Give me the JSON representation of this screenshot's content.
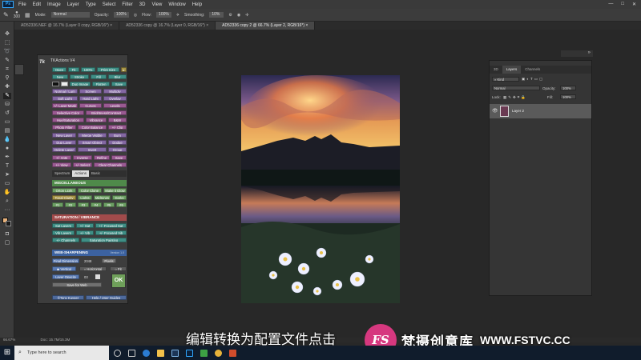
{
  "menubar": {
    "app_badge": "Ps",
    "items": [
      "File",
      "Edit",
      "Image",
      "Layer",
      "Type",
      "Select",
      "Filter",
      "3D",
      "View",
      "Window",
      "Help"
    ],
    "window_controls": [
      "—",
      "□",
      "✕"
    ]
  },
  "options": {
    "brush_size": "300",
    "mode_label": "Mode:",
    "mode_value": "Normal",
    "opacity_label": "Opacity:",
    "opacity_value": "100%",
    "flow_label": "Flow:",
    "flow_value": "100%",
    "smoothing_label": "Smoothing:",
    "smoothing_value": "10%"
  },
  "doc_tabs": [
    {
      "label": "AD52336.NEF @ 16.7% (Layer 0 copy, RGB/16*) ×",
      "active": false
    },
    {
      "label": "AD52336 copy @ 16.7% (Layer 0, RGB/16*) ×",
      "active": false
    },
    {
      "label": "AD52336 copy 2 @ 66.7% (Layer 2, RGB/16*) ×",
      "active": true
    }
  ],
  "tk_panel": {
    "title": "TKActions V4",
    "logo": "Tk",
    "row1": [
      "Open",
      "Fit",
      "100%",
      "Print Size",
      "▸"
    ],
    "row2": [
      "New",
      "Stroke",
      "Fill",
      "Blur"
    ],
    "row3": [
      "Dup Image",
      "Flatten",
      "Save"
    ],
    "row4": [
      "Normal / Lum",
      "Screen",
      "Multiply"
    ],
    "row5": [
      "Soft Light",
      "Hard Light",
      "Overlay"
    ],
    "row6": [
      "+/- Layer Mask",
      "Curves",
      "Levels"
    ],
    "row7": [
      "Selective Color",
      "Brightness/Contrast"
    ],
    "row8": [
      "Hue/Saturation",
      "Vibrance",
      "B&W"
    ],
    "row9": [
      "Photo Filter",
      "Color Balance",
      "+/- Clip"
    ],
    "row10": [
      "New Layer",
      "Merge Visible",
      "Burn"
    ],
    "row11": [
      "Dup Layer",
      "Smart Object",
      "Dodge"
    ],
    "row12": [
      "Delete Layer",
      "Invert",
      "Group"
    ],
    "row13": [
      "+/- Ants",
      "Inverse",
      "Refine",
      "Save"
    ],
    "row14": [
      "+/- View",
      "+/- Select",
      "Clear Channels"
    ],
    "subtabs": [
      "Spectrum",
      "Actions",
      "Basic"
    ],
    "misc_title": "MISCELLANEOUS",
    "misc1": [
      "Orton Light",
      "Color Clone",
      "Make it Glow"
    ],
    "misc2": [
      "Tonal Clarity",
      "Lights",
      "Midtones",
      "Darks"
    ],
    "misc3": [
      "#1",
      "#2",
      "#3",
      "#4",
      "#5",
      "#6"
    ],
    "sat_title": "SATURATION / VIBRANCE",
    "sat1": [
      "Sat Layers",
      "+/- Sat",
      "+/- Focused Sat"
    ],
    "sat2": [
      "Vib Layers",
      "+/- Vib",
      "+/- Focused Vib"
    ],
    "sat3": [
      "+/- Channels",
      "Saturation Painting"
    ],
    "web_title": "WEB-SHARPENING",
    "web_version": "Version 1.0",
    "final_dimension_label": "Final Dimension",
    "final_dimension_value": "2048",
    "pixels": "Pixels",
    "vertical": "Vertical",
    "horizontal": "Horizontal",
    "fit": "Fit",
    "layer_opacity_label": "Layer Opacity",
    "layer_opacity_value": "03",
    "save_for_web": "Save for Web",
    "ok": "OK",
    "footer_left": "©Tony Kuyper",
    "footer_right": "Help / User Guides"
  },
  "layers_panel": {
    "tabs": [
      "3D",
      "Layers",
      "Channels"
    ],
    "active_tab": "Layers",
    "filter_kind": "Kind",
    "blend_mode": "Normal",
    "opacity_label": "Opacity:",
    "opacity_value": "100%",
    "lock_label": "Lock:",
    "fill_label": "Fill:",
    "fill_value": "100%",
    "layer_name": "Layer 2"
  },
  "status": {
    "zoom": "66.67%",
    "doc": "Doc: 15.7M/15.3M"
  },
  "overlay": {
    "subtitle": "编辑转换为配置文件点击",
    "brand_logo": "FS",
    "brand_cn": "梵摄创意库",
    "brand_url": "WWW.FSTVC.CC"
  },
  "taskbar": {
    "search_placeholder": "Type here to search"
  }
}
